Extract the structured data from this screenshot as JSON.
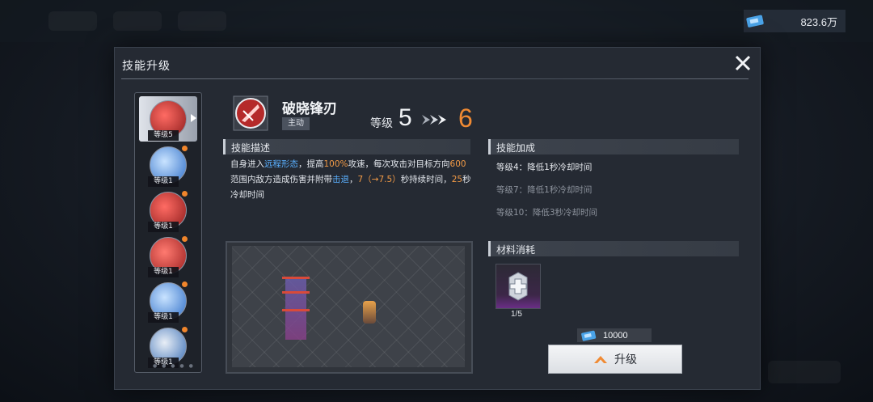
{
  "hud": {
    "currency_amount": "823.6万",
    "currency_icon": "ticket-icon"
  },
  "modal": {
    "title": "技能升级"
  },
  "skill_list": [
    {
      "level_label": "等级5",
      "selected": true,
      "color": "#c8312f"
    },
    {
      "level_label": "等级1",
      "selected": false,
      "color": "#2f6fc8"
    },
    {
      "level_label": "等级1",
      "selected": false,
      "color": "#c8312f"
    },
    {
      "level_label": "等级1",
      "selected": false,
      "color": "#c8312f"
    },
    {
      "level_label": "等级1",
      "selected": false,
      "color": "#2f6fc8"
    },
    {
      "level_label": "等级1",
      "selected": false,
      "color": "#2f6fc8"
    }
  ],
  "skill": {
    "name": "破晓锋刃",
    "tag": "主动",
    "level_label": "等级",
    "current_level": "5",
    "next_level": "6"
  },
  "description": {
    "header": "技能描述",
    "parts": [
      {
        "text": "自身进入",
        "style": "normal"
      },
      {
        "text": "远程形态",
        "style": "blue"
      },
      {
        "text": "，提高",
        "style": "normal"
      },
      {
        "text": "100%",
        "style": "orange"
      },
      {
        "text": "攻速，每次攻击对目标方向",
        "style": "normal"
      },
      {
        "text": "600",
        "style": "orange"
      },
      {
        "text": "范围内敌方造成伤害并附带",
        "style": "normal"
      },
      {
        "text": "击退",
        "style": "blue"
      },
      {
        "text": "，",
        "style": "normal"
      },
      {
        "text": "7（→7.5）",
        "style": "orange"
      },
      {
        "text": "秒持续时间，",
        "style": "normal"
      },
      {
        "text": "25",
        "style": "orange"
      },
      {
        "text": "秒冷却时间",
        "style": "normal"
      }
    ]
  },
  "bonus": {
    "header": "技能加成",
    "items": [
      {
        "text": "等级4：降低1秒冷却时间",
        "active": true
      },
      {
        "text": "等级7：降低1秒冷却时间",
        "active": false
      },
      {
        "text": "等级10：降低3秒冷却时间",
        "active": false
      }
    ]
  },
  "materials": {
    "header": "材料消耗",
    "count": "1/5",
    "icon": "crystal-material-icon"
  },
  "cost": {
    "amount": "10000",
    "icon": "ticket-icon"
  },
  "upgrade_button": {
    "label": "升级",
    "icon": "chevron-up-icon"
  },
  "colors": {
    "accent_orange": "#f08a33",
    "highlight_blue": "#5ab0ff",
    "panel": "#252a33"
  }
}
